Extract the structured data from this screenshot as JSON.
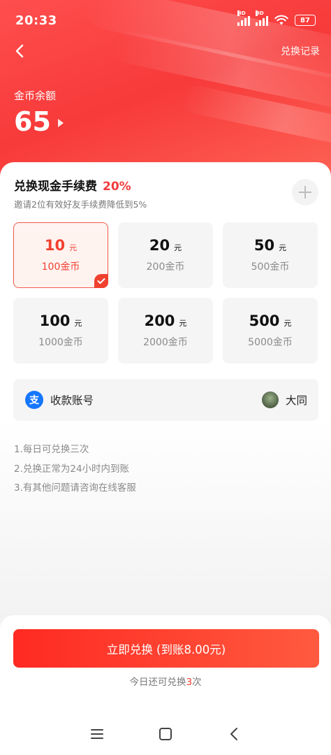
{
  "status_bar": {
    "time": "20:33",
    "battery": "87",
    "signal_tag": "HD"
  },
  "header": {
    "record_link": "兑换记录",
    "balance_label": "金币余额",
    "balance_value": "65"
  },
  "fee": {
    "title": "兑换现金手续费",
    "rate": "20%",
    "tip": "邀请2位有效好友手续费降低到5%"
  },
  "options": [
    {
      "amount": "10",
      "unit": "元",
      "coins": "100金币",
      "selected": true
    },
    {
      "amount": "20",
      "unit": "元",
      "coins": "200金币",
      "selected": false
    },
    {
      "amount": "50",
      "unit": "元",
      "coins": "500金币",
      "selected": false
    },
    {
      "amount": "100",
      "unit": "元",
      "coins": "1000金币",
      "selected": false
    },
    {
      "amount": "200",
      "unit": "元",
      "coins": "2000金币",
      "selected": false
    },
    {
      "amount": "500",
      "unit": "元",
      "coins": "5000金币",
      "selected": false
    }
  ],
  "account": {
    "label": "收款账号",
    "icon_glyph": "支",
    "name": "大同"
  },
  "rules": [
    "1.每日可兑换三次",
    "2.兑换正常为24小时内到账",
    "3.有其他问题请咨询在线客服"
  ],
  "cta": {
    "label": "立即兑换 (到账8.00元)"
  },
  "remaining": {
    "prefix": "今日还可兑换",
    "count": "3",
    "suffix": "次"
  },
  "colors": {
    "accent": "#f0412f",
    "header": "#f73a3a",
    "alipay": "#1677ff"
  },
  "icons": [
    "back-arrow-icon",
    "plus-icon",
    "check-icon",
    "alipay-icon",
    "menu-icon",
    "home-icon",
    "nav-back-icon"
  ]
}
